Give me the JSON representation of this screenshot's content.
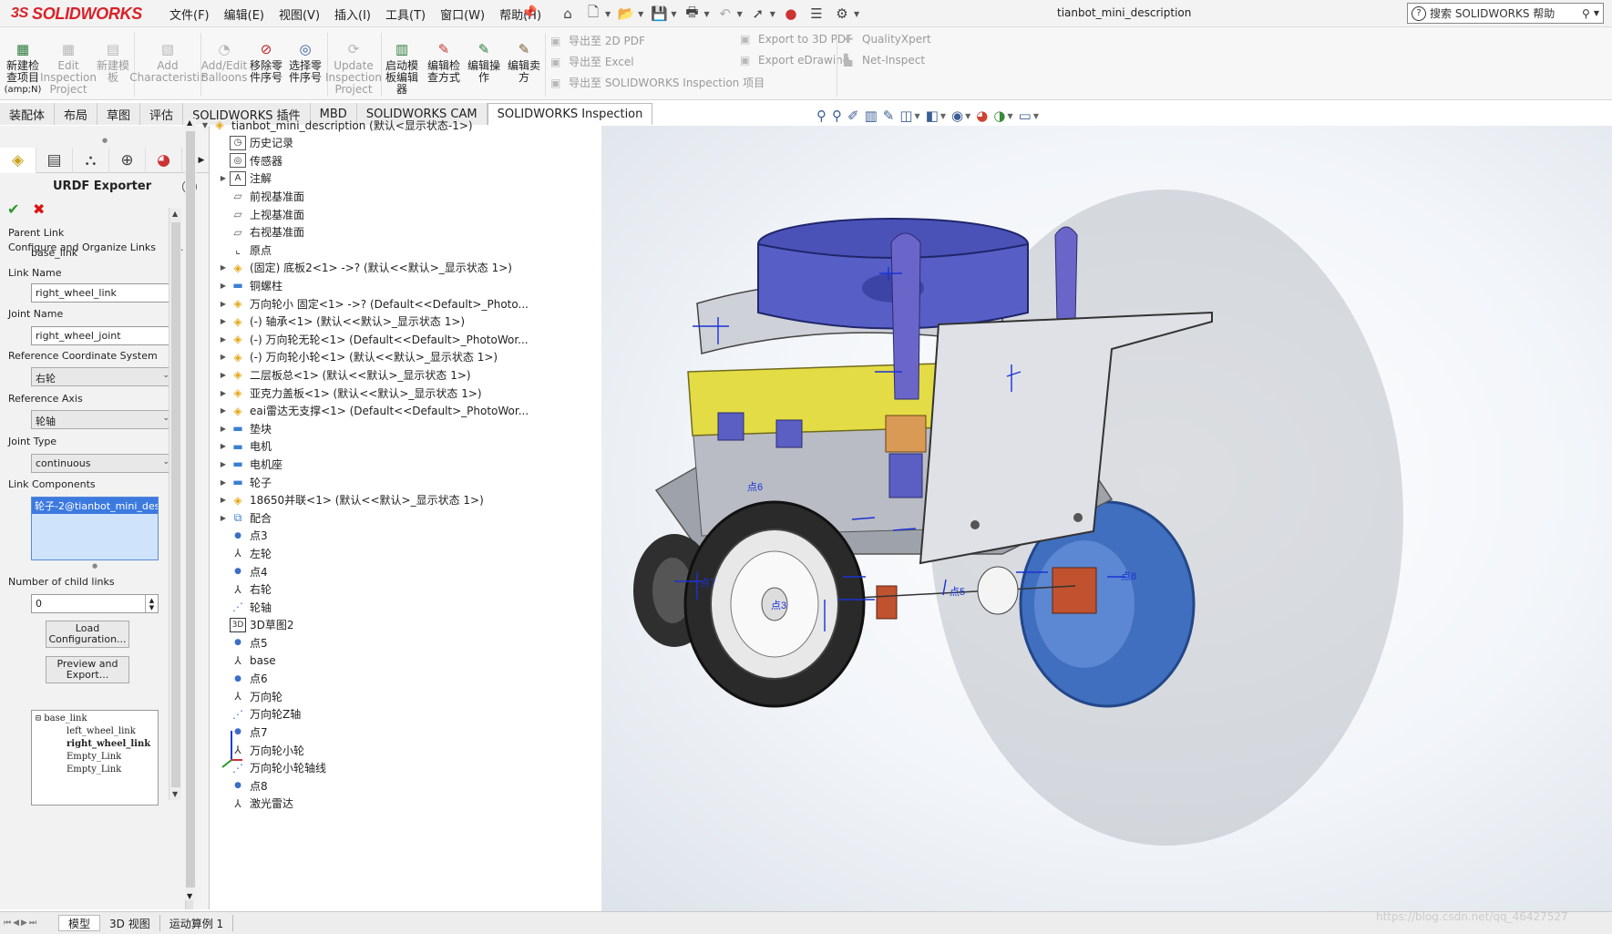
{
  "app": {
    "logo": "SOLIDWORKS",
    "logo_prefix": "3S",
    "document_title": "tianbot_mini_description"
  },
  "menu": [
    "文件(F)",
    "编辑(E)",
    "视图(V)",
    "插入(I)",
    "工具(T)",
    "窗口(W)",
    "帮助(H)"
  ],
  "search": {
    "placeholder": "搜索 SOLIDWORKS 帮助"
  },
  "ribbon": {
    "buttons": [
      {
        "label1": "新建检",
        "label2": "查项目",
        "label3": "(amp;N)",
        "enabled": true
      },
      {
        "label1": "Edit",
        "label2": "Inspection",
        "label3": "Project",
        "enabled": false
      },
      {
        "label1": "新建模",
        "label2": "板",
        "label3": "",
        "enabled": false
      },
      {
        "label1": "Add",
        "label2": "Characteristic",
        "label3": "",
        "enabled": false
      },
      {
        "label1": "Add/Edit",
        "label2": "Balloons",
        "label3": "",
        "enabled": false
      },
      {
        "label1": "移除零",
        "label2": "件序号",
        "label3": "",
        "enabled": true
      },
      {
        "label1": "选择零",
        "label2": "件序号",
        "label3": "",
        "enabled": true
      },
      {
        "label1": "Update",
        "label2": "Inspection",
        "label3": "Project",
        "enabled": false
      },
      {
        "label1": "启动模",
        "label2": "板编辑",
        "label3": "器",
        "enabled": true
      },
      {
        "label1": "编辑检",
        "label2": "查方式",
        "label3": "",
        "enabled": true
      },
      {
        "label1": "编辑操",
        "label2": "作",
        "label3": "",
        "enabled": true
      },
      {
        "label1": "编辑卖",
        "label2": "方",
        "label3": "",
        "enabled": true
      }
    ],
    "export": [
      "导出至 2D PDF",
      "导出至 Excel",
      "导出至 SOLIDWORKS Inspection 项目"
    ],
    "export2": [
      "Export to 3D PDF",
      "Export eDrawing"
    ],
    "extra": [
      "QualityXpert",
      "Net-Inspect"
    ]
  },
  "tabs": [
    {
      "label": "装配体",
      "active": false
    },
    {
      "label": "布局",
      "active": false
    },
    {
      "label": "草图",
      "active": false
    },
    {
      "label": "评估",
      "active": false
    },
    {
      "label": "SOLIDWORKS 插件",
      "active": false
    },
    {
      "label": "MBD",
      "active": false
    },
    {
      "label": "SOLIDWORKS CAM",
      "active": false
    },
    {
      "label": "SOLIDWORKS Inspection",
      "active": true
    }
  ],
  "property_manager": {
    "title": "URDF Exporter",
    "group": "Configure and Organize Links",
    "parent_link_label": "Parent Link",
    "parent_link": "base_link",
    "link_name_label": "Link Name",
    "link_name": "right_wheel_link",
    "joint_name_label": "Joint Name",
    "joint_name": "right_wheel_joint",
    "ref_coord_label": "Reference Coordinate System",
    "ref_coord": "右轮",
    "ref_axis_label": "Reference Axis",
    "ref_axis": "轮轴",
    "joint_type_label": "Joint Type",
    "joint_type": "continuous",
    "link_components_label": "Link Components",
    "link_component": "轮子-2@tianbot_mini_description",
    "child_links_label": "Number of child links",
    "child_links": "0",
    "load_button1": "Load",
    "load_button2": "Configuration...",
    "preview_button1": "Preview and",
    "preview_button2": "Export...",
    "link_tree": [
      "base_link",
      "left_wheel_link",
      "right_wheel_link",
      "Empty_Link",
      "Empty_Link"
    ]
  },
  "feature_tree": [
    {
      "label": "tianbot_mini_description  (默认<显示状态-1>)",
      "icon": "assembly",
      "expanded": true
    },
    {
      "label": "历史记录",
      "icon": "history"
    },
    {
      "label": "传感器",
      "icon": "sensor"
    },
    {
      "label": "注解",
      "icon": "annotation",
      "expand": true
    },
    {
      "label": "前视基准面",
      "icon": "plane"
    },
    {
      "label": "上视基准面",
      "icon": "plane"
    },
    {
      "label": "右视基准面",
      "icon": "plane"
    },
    {
      "label": "原点",
      "icon": "origin"
    },
    {
      "label": "(固定) 底板2<1> ->? (默认<<默认>_显示状态 1>)",
      "icon": "part",
      "expand": true
    },
    {
      "label": "铜螺柱",
      "icon": "folder",
      "expand": true
    },
    {
      "label": "万向轮小 固定<1> ->? (Default<<Default>_Photo...",
      "icon": "part",
      "expand": true
    },
    {
      "label": "(-) 轴承<1> (默认<<默认>_显示状态 1>)",
      "icon": "part",
      "expand": true
    },
    {
      "label": "(-) 万向轮无轮<1> (Default<<Default>_PhotoWor...",
      "icon": "part",
      "expand": true
    },
    {
      "label": "(-) 万向轮小轮<1> (默认<<默认>_显示状态 1>)",
      "icon": "part",
      "expand": true
    },
    {
      "label": "二层板总<1> (默认<<默认>_显示状态 1>)",
      "icon": "part",
      "expand": true
    },
    {
      "label": "亚克力盖板<1> (默认<<默认>_显示状态 1>)",
      "icon": "part",
      "expand": true
    },
    {
      "label": "eai雷达无支撑<1> (Default<<Default>_PhotoWor...",
      "icon": "part",
      "expand": true
    },
    {
      "label": "垫块",
      "icon": "folder",
      "expand": true
    },
    {
      "label": "电机",
      "icon": "folder",
      "expand": true
    },
    {
      "label": "电机座",
      "icon": "folder",
      "expand": true
    },
    {
      "label": "轮子",
      "icon": "folder",
      "expand": true
    },
    {
      "label": "18650并联<1> (默认<<默认>_显示状态 1>)",
      "icon": "part",
      "expand": true
    },
    {
      "label": "配合",
      "icon": "mate",
      "expand": true
    },
    {
      "label": "点3",
      "icon": "point"
    },
    {
      "label": "左轮",
      "icon": "coord"
    },
    {
      "label": "点4",
      "icon": "point"
    },
    {
      "label": "右轮",
      "icon": "coord"
    },
    {
      "label": "轮轴",
      "icon": "axis"
    },
    {
      "label": "3D草图2",
      "icon": "sketch3d"
    },
    {
      "label": "点5",
      "icon": "point"
    },
    {
      "label": "base",
      "icon": "coord"
    },
    {
      "label": "点6",
      "icon": "point"
    },
    {
      "label": "万向轮",
      "icon": "coord"
    },
    {
      "label": "万向轮Z轴",
      "icon": "axis"
    },
    {
      "label": "点7",
      "icon": "point"
    },
    {
      "label": "万向轮小轮",
      "icon": "coord"
    },
    {
      "label": "万向轮小轮轴线",
      "icon": "axis"
    },
    {
      "label": "点8",
      "icon": "point"
    },
    {
      "label": "激光雷达",
      "icon": "coord"
    }
  ],
  "viewport_labels": [
    "点3",
    "点5",
    "点6",
    "点7",
    "点8"
  ],
  "bottom_tabs": [
    {
      "label": "模型",
      "active": true
    },
    {
      "label": "3D 视图",
      "active": false
    },
    {
      "label": "运动算例 1",
      "active": false
    }
  ],
  "watermark": "https://blog.csdn.net/qq_46427527",
  "colors": {
    "brand": "#da2128",
    "accent": "#3c7ae0",
    "robot_body": "#c9cbd3",
    "lidar": "#5a63c9",
    "wheel_blue": "#3f74c8",
    "yellow_board": "#e8e14a"
  }
}
